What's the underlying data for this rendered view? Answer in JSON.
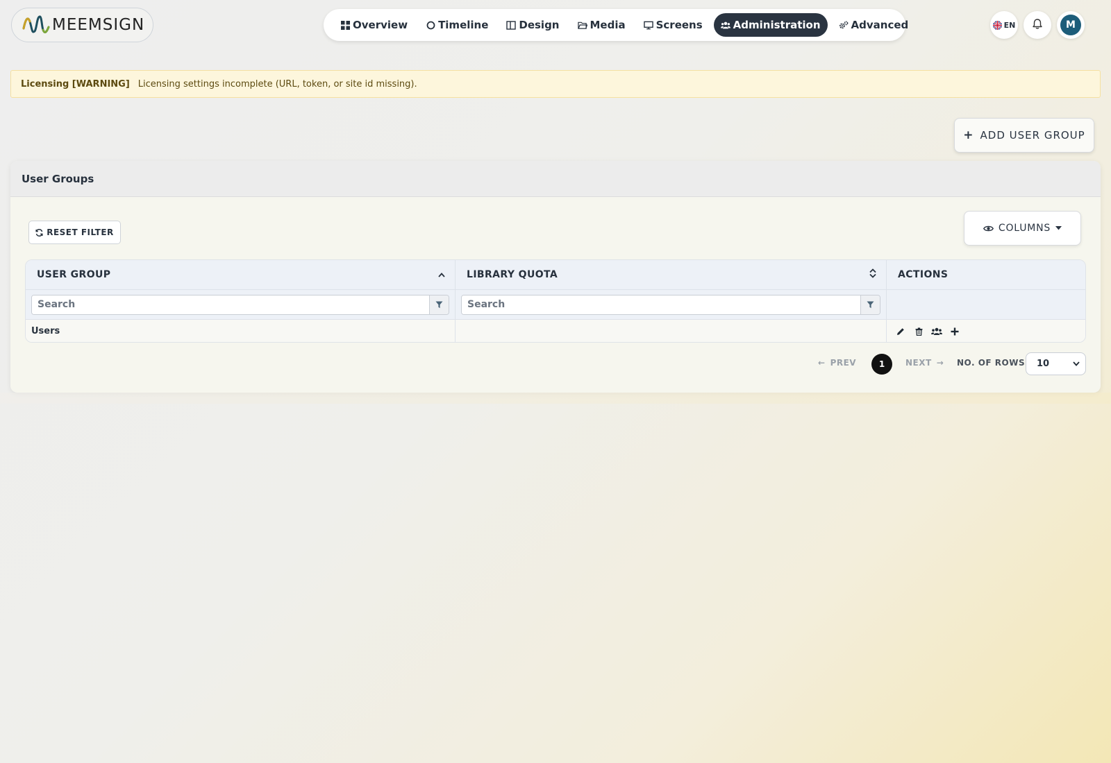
{
  "brand": {
    "name": "MEEMSIGN"
  },
  "nav": [
    {
      "label": "Overview",
      "icon": "grid-icon",
      "active": false
    },
    {
      "label": "Timeline",
      "icon": "circle-icon",
      "active": false
    },
    {
      "label": "Design",
      "icon": "layout-icon",
      "active": false
    },
    {
      "label": "Media",
      "icon": "folder-icon",
      "active": false
    },
    {
      "label": "Screens",
      "icon": "monitor-icon",
      "active": false
    },
    {
      "label": "Administration",
      "icon": "users-icon",
      "active": true
    },
    {
      "label": "Advanced",
      "icon": "cogs-icon",
      "active": false
    }
  ],
  "header_right": {
    "language": "EN",
    "avatar_initial": "M"
  },
  "alert": {
    "title": "Licensing [WARNING]",
    "message": "Licensing settings incomplete (URL, token, or site id missing)."
  },
  "add_button": {
    "label": "ADD USER GROUP"
  },
  "card": {
    "title": "User Groups",
    "reset_filter_label": "RESET FILTER",
    "columns_label": "COLUMNS"
  },
  "table": {
    "columns": [
      "USER GROUP",
      "LIBRARY QUOTA",
      "ACTIONS"
    ],
    "filters": [
      {
        "placeholder": "Search",
        "value": ""
      },
      {
        "placeholder": "Search",
        "value": ""
      }
    ],
    "rows": [
      {
        "user_group": "Users",
        "library_quota": "",
        "actions": [
          "edit-icon",
          "trash-icon",
          "members-icon",
          "plus-icon"
        ]
      }
    ]
  },
  "pagination": {
    "prev_label": "PREV",
    "next_label": "NEXT",
    "current_page": "1",
    "rows_label": "NO. OF ROWS",
    "rows_value": "10"
  },
  "colors": {
    "accent_dark": "#2a3441",
    "avatar_bg": "#1d5d7a",
    "alert_bg": "#fdf6dc",
    "alert_border": "#f5e0a0",
    "alert_text": "#5c4a10"
  }
}
